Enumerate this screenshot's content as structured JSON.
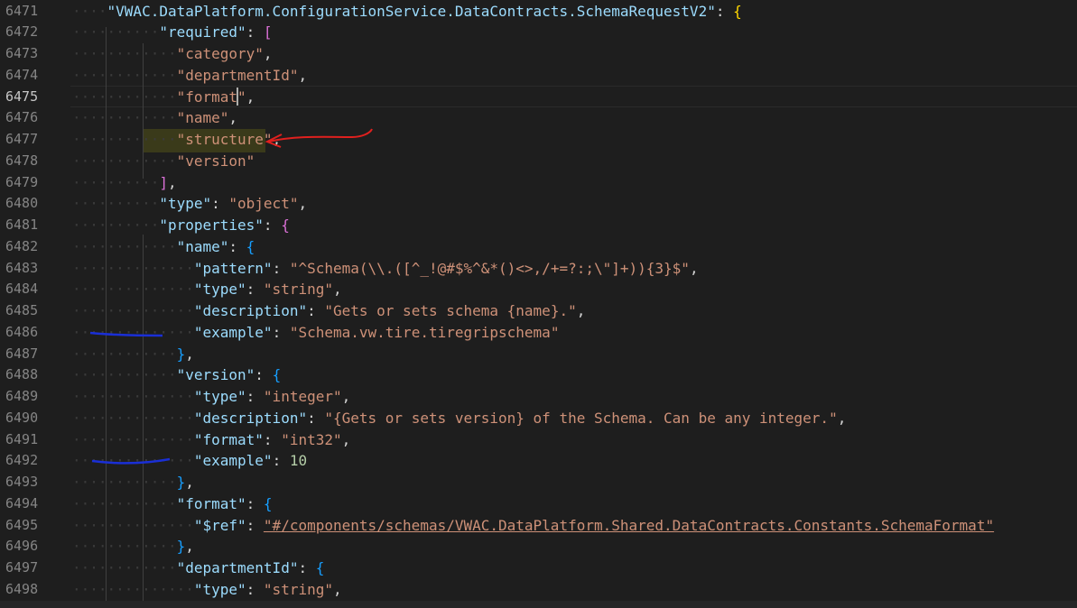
{
  "editor": {
    "current_line": "6475",
    "lines": [
      {
        "no": "6471",
        "indent": "····",
        "tokens": [
          {
            "t": "\"VWAC.DataPlatform.ConfigurationService.DataContracts.SchemaRequestV2\"",
            "c": "key"
          },
          {
            "t": ": ",
            "c": "p"
          },
          {
            "t": "{",
            "c": "b1"
          }
        ]
      },
      {
        "no": "6472",
        "indent": "··········",
        "tokens": [
          {
            "t": "\"required\"",
            "c": "key"
          },
          {
            "t": ": ",
            "c": "p"
          },
          {
            "t": "[",
            "c": "b2"
          }
        ]
      },
      {
        "no": "6473",
        "indent": "············",
        "tokens": [
          {
            "t": "\"category\"",
            "c": "str"
          },
          {
            "t": ",",
            "c": "p"
          }
        ]
      },
      {
        "no": "6474",
        "indent": "············",
        "tokens": [
          {
            "t": "\"departmentId\"",
            "c": "str"
          },
          {
            "t": ",",
            "c": "p"
          }
        ]
      },
      {
        "no": "6475",
        "indent": "············",
        "tokens": [
          {
            "t": "\"format\"",
            "c": "str"
          },
          {
            "t": ",",
            "c": "p"
          }
        ]
      },
      {
        "no": "6476",
        "indent": "············",
        "tokens": [
          {
            "t": "\"name\"",
            "c": "str"
          },
          {
            "t": ",",
            "c": "p"
          }
        ]
      },
      {
        "no": "6477",
        "indent": "············",
        "tokens": [
          {
            "t": "\"structure\"",
            "c": "str"
          },
          {
            "t": ",",
            "c": "p"
          }
        ]
      },
      {
        "no": "6478",
        "indent": "············",
        "tokens": [
          {
            "t": "\"version\"",
            "c": "str"
          }
        ]
      },
      {
        "no": "6479",
        "indent": "··········",
        "tokens": [
          {
            "t": "]",
            "c": "b2"
          },
          {
            "t": ",",
            "c": "p"
          }
        ]
      },
      {
        "no": "6480",
        "indent": "··········",
        "tokens": [
          {
            "t": "\"type\"",
            "c": "key"
          },
          {
            "t": ": ",
            "c": "p"
          },
          {
            "t": "\"object\"",
            "c": "str"
          },
          {
            "t": ",",
            "c": "p"
          }
        ]
      },
      {
        "no": "6481",
        "indent": "··········",
        "tokens": [
          {
            "t": "\"properties\"",
            "c": "key"
          },
          {
            "t": ": ",
            "c": "p"
          },
          {
            "t": "{",
            "c": "b2"
          }
        ]
      },
      {
        "no": "6482",
        "indent": "············",
        "tokens": [
          {
            "t": "\"name\"",
            "c": "key"
          },
          {
            "t": ": ",
            "c": "p"
          },
          {
            "t": "{",
            "c": "b3"
          }
        ]
      },
      {
        "no": "6483",
        "indent": "··············",
        "tokens": [
          {
            "t": "\"pattern\"",
            "c": "key"
          },
          {
            "t": ": ",
            "c": "p"
          },
          {
            "t": "\"^Schema(\\\\.([^_!@#$%^&*()<>,/+=?:;\\\"]+)){3}$\"",
            "c": "str"
          },
          {
            "t": ",",
            "c": "p"
          }
        ]
      },
      {
        "no": "6484",
        "indent": "··············",
        "tokens": [
          {
            "t": "\"type\"",
            "c": "key"
          },
          {
            "t": ": ",
            "c": "p"
          },
          {
            "t": "\"string\"",
            "c": "str"
          },
          {
            "t": ",",
            "c": "p"
          }
        ]
      },
      {
        "no": "6485",
        "indent": "··············",
        "tokens": [
          {
            "t": "\"description\"",
            "c": "key"
          },
          {
            "t": ": ",
            "c": "p"
          },
          {
            "t": "\"Gets or sets schema {name}.\"",
            "c": "str"
          },
          {
            "t": ",",
            "c": "p"
          }
        ]
      },
      {
        "no": "6486",
        "indent": "··············",
        "tokens": [
          {
            "t": "\"example\"",
            "c": "key"
          },
          {
            "t": ": ",
            "c": "p"
          },
          {
            "t": "\"Schema.vw.tire.tiregripschema\"",
            "c": "str"
          }
        ]
      },
      {
        "no": "6487",
        "indent": "············",
        "tokens": [
          {
            "t": "}",
            "c": "b3"
          },
          {
            "t": ",",
            "c": "p"
          }
        ]
      },
      {
        "no": "6488",
        "indent": "············",
        "tokens": [
          {
            "t": "\"version\"",
            "c": "key"
          },
          {
            "t": ": ",
            "c": "p"
          },
          {
            "t": "{",
            "c": "b3"
          }
        ]
      },
      {
        "no": "6489",
        "indent": "··············",
        "tokens": [
          {
            "t": "\"type\"",
            "c": "key"
          },
          {
            "t": ": ",
            "c": "p"
          },
          {
            "t": "\"integer\"",
            "c": "str"
          },
          {
            "t": ",",
            "c": "p"
          }
        ]
      },
      {
        "no": "6490",
        "indent": "··············",
        "tokens": [
          {
            "t": "\"description\"",
            "c": "key"
          },
          {
            "t": ": ",
            "c": "p"
          },
          {
            "t": "\"{Gets or sets version} of the Schema. Can be any integer.\"",
            "c": "str"
          },
          {
            "t": ",",
            "c": "p"
          }
        ]
      },
      {
        "no": "6491",
        "indent": "··············",
        "tokens": [
          {
            "t": "\"format\"",
            "c": "key"
          },
          {
            "t": ": ",
            "c": "p"
          },
          {
            "t": "\"int32\"",
            "c": "str"
          },
          {
            "t": ",",
            "c": "p"
          }
        ]
      },
      {
        "no": "6492",
        "indent": "··············",
        "tokens": [
          {
            "t": "\"example\"",
            "c": "key"
          },
          {
            "t": ": ",
            "c": "p"
          },
          {
            "t": "10",
            "c": "num"
          }
        ]
      },
      {
        "no": "6493",
        "indent": "············",
        "tokens": [
          {
            "t": "}",
            "c": "b3"
          },
          {
            "t": ",",
            "c": "p"
          }
        ]
      },
      {
        "no": "6494",
        "indent": "············",
        "tokens": [
          {
            "t": "\"format\"",
            "c": "key"
          },
          {
            "t": ": ",
            "c": "p"
          },
          {
            "t": "{",
            "c": "b3"
          }
        ]
      },
      {
        "no": "6495",
        "indent": "··············",
        "tokens": [
          {
            "t": "\"$ref\"",
            "c": "key"
          },
          {
            "t": ": ",
            "c": "p"
          },
          {
            "t": "\"#/components/schemas/VWAC.DataPlatform.Shared.DataContracts.Constants.SchemaFormat\"",
            "c": "str link"
          }
        ]
      },
      {
        "no": "6496",
        "indent": "············",
        "tokens": [
          {
            "t": "}",
            "c": "b3"
          },
          {
            "t": ",",
            "c": "p"
          }
        ]
      },
      {
        "no": "6497",
        "indent": "············",
        "tokens": [
          {
            "t": "\"departmentId\"",
            "c": "key"
          },
          {
            "t": ": ",
            "c": "p"
          },
          {
            "t": "{",
            "c": "b3"
          }
        ]
      },
      {
        "no": "6498",
        "indent": "··············",
        "tokens": [
          {
            "t": "\"type\"",
            "c": "key"
          },
          {
            "t": ": ",
            "c": "p"
          },
          {
            "t": "\"string\"",
            "c": "str"
          },
          {
            "t": ",",
            "c": "p"
          }
        ]
      }
    ]
  },
  "annotations": {
    "red_arrow_color": "#e0201e",
    "blue_underline_color": "#1a2fd6"
  }
}
